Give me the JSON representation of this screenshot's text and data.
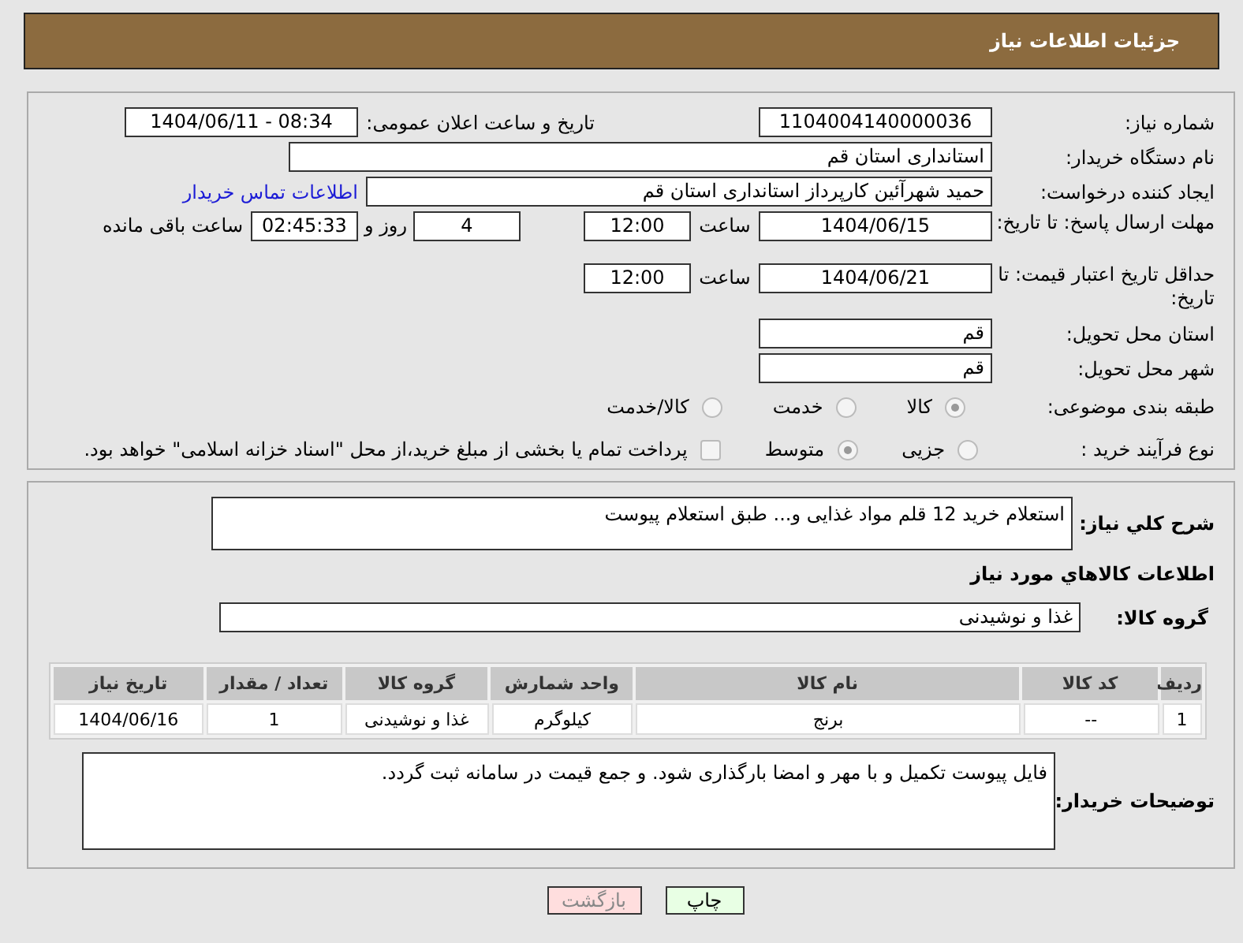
{
  "header": {
    "title": "جزئیات اطلاعات نیاز"
  },
  "need_number": {
    "label": "شماره نیاز:",
    "value": "1104004140000036"
  },
  "announce": {
    "label": "تاریخ و ساعت اعلان عمومی:",
    "value": "1404/06/11 - 08:34"
  },
  "buyer_org": {
    "label": "نام دستگاه خریدار:",
    "value": "استانداری استان قم"
  },
  "requester": {
    "label": "ایجاد کننده درخواست:",
    "value": "حمید شهرآئین کارپرداز استانداری استان قم",
    "link": "اطلاعات تماس خریدار"
  },
  "reply_deadline": {
    "label": "مهلت ارسال پاسخ: تا تاریخ:",
    "date": "1404/06/15",
    "time_label": "ساعت",
    "time": "12:00",
    "days": "4",
    "days_label": "روز و",
    "remaining": "02:45:33",
    "remaining_label": "ساعت باقی مانده"
  },
  "price_validity": {
    "label": "حداقل تاریخ اعتبار قیمت: تا تاریخ:",
    "date": "1404/06/21",
    "time_label": "ساعت",
    "time": "12:00"
  },
  "province": {
    "label": "استان محل تحویل:",
    "value": "قم"
  },
  "city": {
    "label": "شهر محل تحویل:",
    "value": "قم"
  },
  "category": {
    "label": "طبقه بندی موضوعی:",
    "options": [
      {
        "kind": "radio",
        "label": "كالا",
        "selected": true
      },
      {
        "kind": "radio",
        "label": "خدمت",
        "selected": false
      },
      {
        "kind": "radio",
        "label": "كالا/خدمت",
        "selected": false
      }
    ]
  },
  "process": {
    "label": "نوع فرآیند خرید :",
    "options": [
      {
        "kind": "radio",
        "label": "جزیی",
        "selected": false
      },
      {
        "kind": "radio",
        "label": "متوسط",
        "selected": true
      },
      {
        "kind": "checkbox",
        "label": "پرداخت تمام یا بخشی از مبلغ خرید،از محل \"اسناد خزانه اسلامی\" خواهد بود.",
        "selected": false
      }
    ]
  },
  "description": {
    "label": "شرح كلي نياز:",
    "value": "استعلام خرید 12 قلم مواد غذایی و... طبق استعلام پیوست"
  },
  "goods_heading": "اطلاعات كالاهاي مورد نياز",
  "goods_group": {
    "label": "گروه کالا:",
    "value": "غذا و نوشیدنی"
  },
  "table": {
    "columns": [
      "ردیف",
      "کد کالا",
      "نام کالا",
      "واحد شمارش",
      "گروه کالا",
      "تعداد / مقدار",
      "تاریخ نیاز"
    ],
    "rows": [
      [
        "1",
        "--",
        "برنج",
        "کیلوگرم",
        "غذا و نوشیدنی",
        "1",
        "1404/06/16"
      ]
    ]
  },
  "buyer_notes": {
    "label": "توضیحات خریدار:",
    "value": "فایل پیوست تکمیل و با مهر و امضا بارگذاری شود. و جمع قیمت در سامانه ثبت گردد."
  },
  "buttons": [
    {
      "kind": "print",
      "label": "چاپ"
    },
    {
      "kind": "back",
      "label": "بازگشت"
    }
  ]
}
